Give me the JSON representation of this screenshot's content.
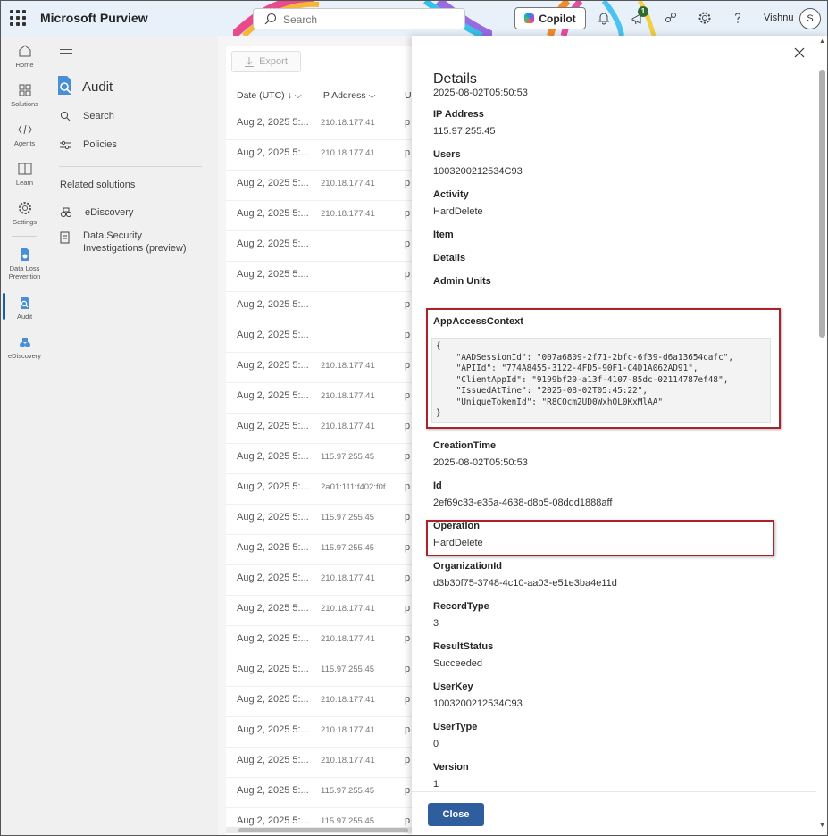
{
  "topbar": {
    "brand": "Microsoft Purview",
    "search_placeholder": "Search",
    "copilot_label": "Copilot",
    "notification_count": "1",
    "user_name": "Vishnu",
    "avatar_initial": "S"
  },
  "rail": {
    "items": [
      {
        "label": "Home"
      },
      {
        "label": "Solutions"
      },
      {
        "label": "Agents"
      },
      {
        "label": "Learn"
      },
      {
        "label": "Settings"
      },
      {
        "label": "Data Loss Prevention"
      },
      {
        "label": "Audit"
      },
      {
        "label": "eDiscovery"
      }
    ]
  },
  "nav": {
    "app_title": "Audit",
    "items": [
      {
        "label": "Search"
      },
      {
        "label": "Policies"
      }
    ],
    "related_heading": "Related solutions",
    "related": [
      {
        "label": "eDiscovery"
      },
      {
        "label": "Data Security Investigations (preview)"
      }
    ]
  },
  "table": {
    "export_label": "Export",
    "columns": [
      "Date (UTC)",
      "IP Address",
      "U"
    ],
    "rows": [
      {
        "date": "Aug 2, 2025 5:...",
        "ip": "210.18.177.41",
        "u": "p"
      },
      {
        "date": "Aug 2, 2025 5:...",
        "ip": "210.18.177.41",
        "u": "p"
      },
      {
        "date": "Aug 2, 2025 5:...",
        "ip": "210.18.177.41",
        "u": "p"
      },
      {
        "date": "Aug 2, 2025 5:...",
        "ip": "210.18.177.41",
        "u": "p"
      },
      {
        "date": "Aug 2, 2025 5:...",
        "ip": "",
        "u": "p"
      },
      {
        "date": "Aug 2, 2025 5:...",
        "ip": "",
        "u": "p"
      },
      {
        "date": "Aug 2, 2025 5:...",
        "ip": "",
        "u": "p"
      },
      {
        "date": "Aug 2, 2025 5:...",
        "ip": "",
        "u": "p"
      },
      {
        "date": "Aug 2, 2025 5:...",
        "ip": "210.18.177.41",
        "u": "p"
      },
      {
        "date": "Aug 2, 2025 5:...",
        "ip": "210.18.177.41",
        "u": "p"
      },
      {
        "date": "Aug 2, 2025 5:...",
        "ip": "210.18.177.41",
        "u": "p"
      },
      {
        "date": "Aug 2, 2025 5:...",
        "ip": "115.97.255.45",
        "u": "p"
      },
      {
        "date": "Aug 2, 2025 5:...",
        "ip": "2a01:111:f402:f0f...",
        "u": "p"
      },
      {
        "date": "Aug 2, 2025 5:...",
        "ip": "115.97.255.45",
        "u": "p"
      },
      {
        "date": "Aug 2, 2025 5:...",
        "ip": "115.97.255.45",
        "u": "p"
      },
      {
        "date": "Aug 2, 2025 5:...",
        "ip": "210.18.177.41",
        "u": "p"
      },
      {
        "date": "Aug 2, 2025 5:...",
        "ip": "210.18.177.41",
        "u": "p"
      },
      {
        "date": "Aug 2, 2025 5:...",
        "ip": "210.18.177.41",
        "u": "p"
      },
      {
        "date": "Aug 2, 2025 5:...",
        "ip": "115.97.255.45",
        "u": "p"
      },
      {
        "date": "Aug 2, 2025 5:...",
        "ip": "210.18.177.41",
        "u": "p"
      },
      {
        "date": "Aug 2, 2025 5:...",
        "ip": "210.18.177.41",
        "u": "p"
      },
      {
        "date": "Aug 2, 2025 5:...",
        "ip": "210.18.177.41",
        "u": "p"
      },
      {
        "date": "Aug 2, 2025 5:...",
        "ip": "115.97.255.45",
        "u": "p"
      },
      {
        "date": "Aug 2, 2025 5:...",
        "ip": "115.97.255.45",
        "u": "p"
      }
    ]
  },
  "details": {
    "title": "Details",
    "subtitle": "2025-08-02T05:50:53",
    "fields": [
      {
        "label": "IP Address",
        "value": "115.97.255.45"
      },
      {
        "label": "Users",
        "value": "1003200212534C93"
      },
      {
        "label": "Activity",
        "value": "HardDelete"
      },
      {
        "label": "Item",
        "value": ""
      },
      {
        "label": "Details",
        "value": ""
      },
      {
        "label": "Admin Units",
        "value": ""
      }
    ],
    "app_access_label": "AppAccessContext",
    "app_access_code": "{\n    \"AADSessionId\": \"007a6809-2f71-2bfc-6f39-d6a13654cafc\",\n    \"APIId\": \"774A8455-3122-4FD5-90F1-C4D1A062AD91\",\n    \"ClientAppId\": \"9199bf20-a13f-4107-85dc-02114787ef48\",\n    \"IssuedAtTime\": \"2025-08-02T05:45:22\",\n    \"UniqueTokenId\": \"R8COcm2UD0WxhOL0KxMlAA\"\n}",
    "more_fields": [
      {
        "label": "CreationTime",
        "value": "2025-08-02T05:50:53"
      },
      {
        "label": "Id",
        "value": "2ef69c33-e35a-4638-d8b5-08ddd1888aff"
      },
      {
        "label": "Operation",
        "value": "HardDelete"
      },
      {
        "label": "OrganizationId",
        "value": "d3b30f75-3748-4c10-aa03-e51e3ba4e11d"
      },
      {
        "label": "RecordType",
        "value": "3"
      },
      {
        "label": "ResultStatus",
        "value": "Succeeded"
      },
      {
        "label": "UserKey",
        "value": "1003200212534C93"
      },
      {
        "label": "UserType",
        "value": "0"
      },
      {
        "label": "Version",
        "value": "1"
      }
    ],
    "close_label": "Close"
  }
}
